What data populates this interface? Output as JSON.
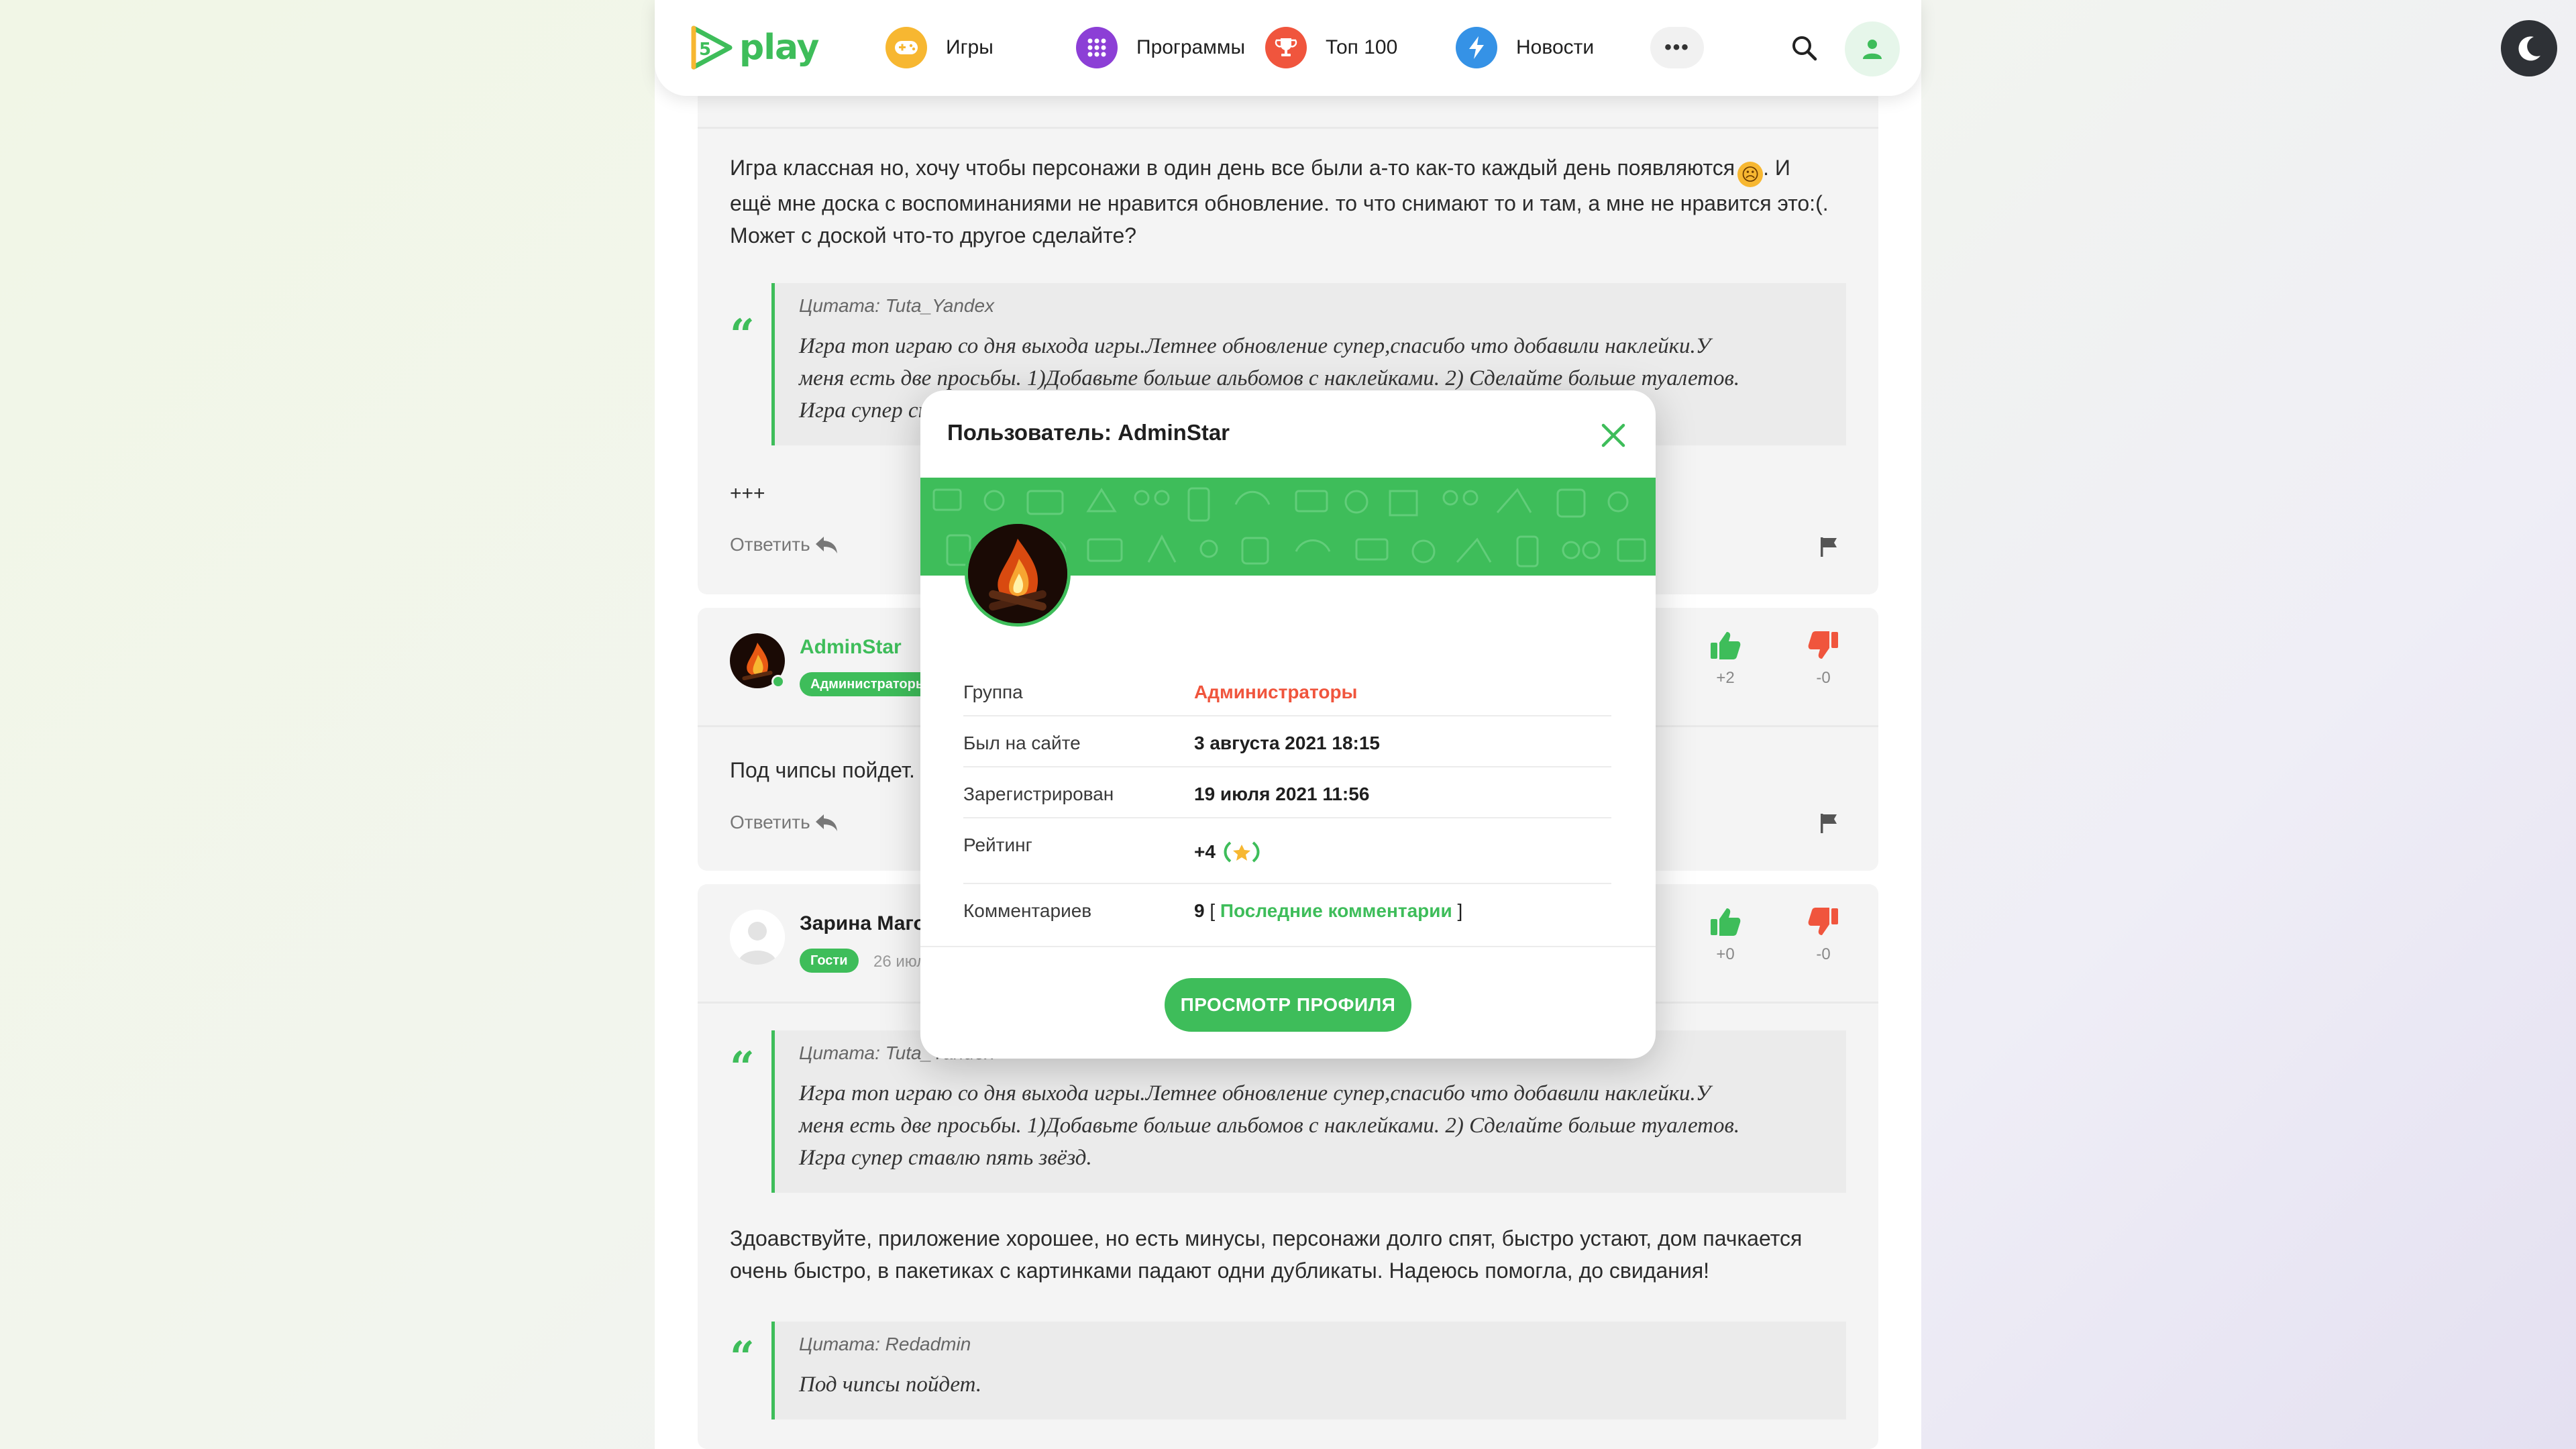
{
  "header": {
    "logo_text": "play",
    "logo_digit": "5",
    "nav": [
      {
        "label": "Игры",
        "icon": "gamepad-icon",
        "color": "#f7b731"
      },
      {
        "label": "Программы",
        "icon": "grid-icon",
        "color": "#8c3fd6"
      },
      {
        "label": "Топ 100",
        "icon": "trophy-icon",
        "color": "#f0553d"
      },
      {
        "label": "Новости",
        "icon": "lightning-icon",
        "color": "#3592e6"
      }
    ],
    "more": "•••"
  },
  "comments": {
    "c1": {
      "text_line1": "Игра классная но, хочу чтобы персонажи в один день все были а-то как-то каждый день появляются",
      "text_line1_end": ". И",
      "text_line2": "ещё мне доска с воспоминаниями не нравится обновление. то что снимают то и там, а мне не нравится это:(.",
      "text_line3": "Может с доской что-то другое сделайте?",
      "quote_author": "Цитата: Tuta_Yandex",
      "quote_line1": "Игра топ играю со дня выхода игры.Летнее обновление супер,спасибо что добавили наклейки.У",
      "quote_line2": "меня есть две просьбы. 1)Добавьте больше альбомов с наклейками. 2) Сделайте больше туалетов.",
      "quote_line3": "Игра супер ставлю пять звёзд.",
      "extra": "+++",
      "reply": "Ответить"
    },
    "c2": {
      "user": "AdminStar",
      "badge": "Администраторы",
      "up": "+2",
      "down": "-0",
      "text": "Под чипсы пойдет.",
      "reply": "Ответить"
    },
    "c3": {
      "user": "Зарина Магомедова",
      "badge": "Гости",
      "date": "26 июля 2021",
      "up": "+0",
      "down": "-0",
      "quote_author": "Цитата: Tuta_Yandex",
      "quote_line1": "Игра топ играю со дня выхода игры.Летнее обновление супер,спасибо что добавили наклейки.У",
      "quote_line2": "меня есть две просьбы. 1)Добавьте больше альбомов с наклейками. 2) Сделайте больше туалетов.",
      "quote_line3": "Игра супер ставлю пять звёзд.",
      "text_line1": "Здоавствуйте, приложение хорошее, но есть минусы, персонажи долго спят, быстро устают, дом пачкается",
      "text_line2": "очень быстро, в пакетиках с картинками падают одни дубликаты. Надеюсь помогла, до свидания!",
      "quote2_author": "Цитата: Redadmin",
      "quote2_body": "Под чипсы пойдет."
    }
  },
  "modal": {
    "title": "Пользователь: AdminStar",
    "rows": [
      {
        "label": "Группа",
        "value": "Администраторы",
        "color": "#f0553d"
      },
      {
        "label": "Был на сайте",
        "value": "3 августа 2021 18:15"
      },
      {
        "label": "Зарегистрирован",
        "value": "19 июля 2021 11:56"
      },
      {
        "label": "Рейтинг",
        "value": "+4"
      },
      {
        "label": "Комментариев",
        "value": "9",
        "bracket_open": "[",
        "link": "Последние комментарии",
        "bracket_close": "]"
      }
    ],
    "button": "ПРОСМОТР ПРОФИЛЯ"
  },
  "colors": {
    "accent": "#3ebd5a",
    "danger": "#f0553d"
  }
}
